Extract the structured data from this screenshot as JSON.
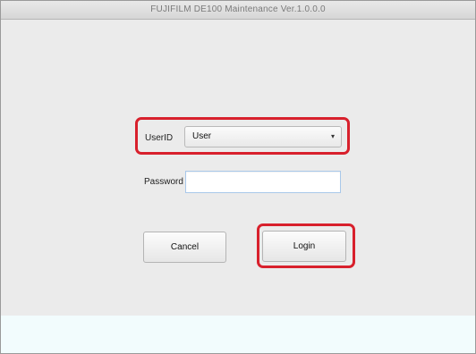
{
  "window": {
    "title": "FUJIFILM DE100 Maintenance Ver.1.0.0.0"
  },
  "login_form": {
    "userid_label": "UserID",
    "userid_value": "User",
    "password_label": "Password",
    "password_value": "",
    "cancel_label": "Cancel",
    "login_label": "Login"
  },
  "icons": {
    "dropdown": "chevron-down-icon"
  },
  "colors": {
    "highlight": "#d8202c",
    "footer_band": "#f2fcfd"
  }
}
